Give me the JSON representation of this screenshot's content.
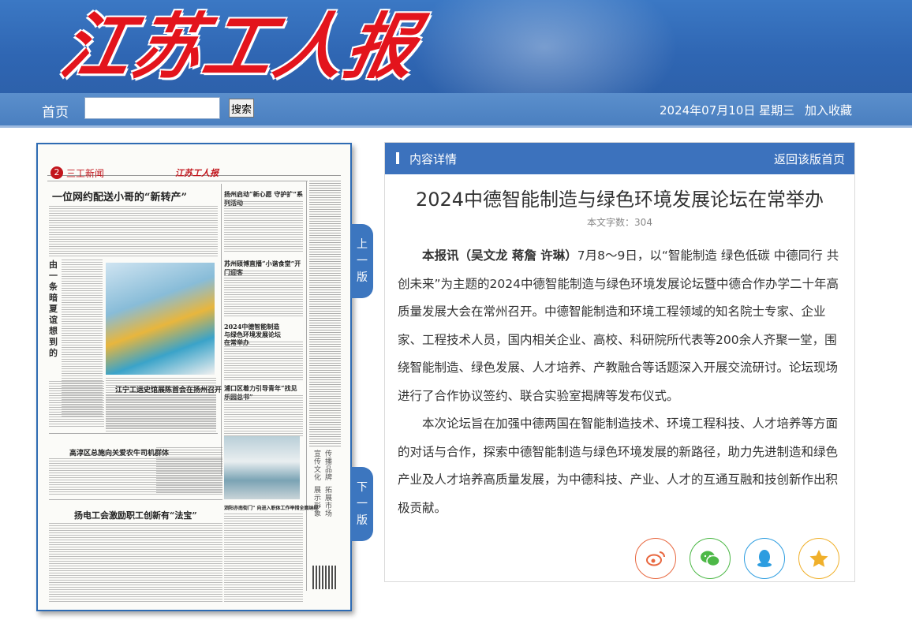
{
  "header": {
    "logo_chars": [
      "江",
      "苏",
      "工",
      "人",
      "报"
    ]
  },
  "nav": {
    "home": "首页",
    "search_placeholder": "",
    "search_button": "搜索",
    "date": "2024年07月10日 星期三",
    "favorite": "加入收藏"
  },
  "paper": {
    "page_number": "2",
    "section": "三工新闻",
    "masthead": "江苏工人报",
    "headlines": [
      "一位网约配送小哥的“新转产”",
      "扬州启动“新心愿 守护扩”系列活动",
      "苏州硕博直播“小谐食堂”开门迎客",
      "2024中德智能制造与绿色环境发展论坛在常举办",
      "江宁工运史馆展陈首会在扬州召开",
      "浦口区着力引导青年“找见乐园总书”",
      "高淳区总施向关爱农牛司机群体",
      "扬电工会激励职工创新有“法宝”",
      "泗阳亦南街门“ 向进入职体工作举措全面纳绑”"
    ],
    "side_heading": "由一条暗夏谊想到的",
    "side_ad": [
      "宣传文化",
      "传播品牌",
      "展示形象",
      "拓展市场"
    ],
    "tab_prev": [
      "上",
      "一",
      "版"
    ],
    "tab_next": [
      "下",
      "一",
      "版"
    ]
  },
  "article": {
    "panel_title": "内容详情",
    "back_link": "返回该版首页",
    "title": "2024中德智能制造与绿色环境发展论坛在常举办",
    "word_count": "本文字数：304",
    "byline": "本报讯（吴文龙  蒋詹  许琳）",
    "para1": "7月8～9日，以“智能制造 绿色低碳 中德同行 共创未来”为主题的2024中德智能制造与绿色环境发展论坛暨中德合作办学二十年高质量发展大会在常州召开。中德智能制造和环境工程领域的知名院士专家、企业家、工程技术人员，国内相关企业、高校、科研院所代表等200余人齐聚一堂，围绕智能制造、绿色发展、人才培养、产教融合等话题深入开展交流研讨。论坛现场进行了合作协议签约、联合实验室揭牌等发布仪式。",
    "para2": "本次论坛旨在加强中德两国在智能制造技术、环境工程科技、人才培养等方面的对话与合作，探索中德智能制造与绿色环境发展的新路径，助力先进制造和绿色产业及人才培养高质量发展，为中德科技、产业、人才的互通互融和技创新作出积极贡献。"
  },
  "share": [
    {
      "name": "weibo-share-icon",
      "color": "#e8673f"
    },
    {
      "name": "wechat-share-icon",
      "color": "#4db847"
    },
    {
      "name": "qq-share-icon",
      "color": "#2d9de0"
    },
    {
      "name": "qzone-share-icon",
      "color": "#f0b02b"
    }
  ]
}
